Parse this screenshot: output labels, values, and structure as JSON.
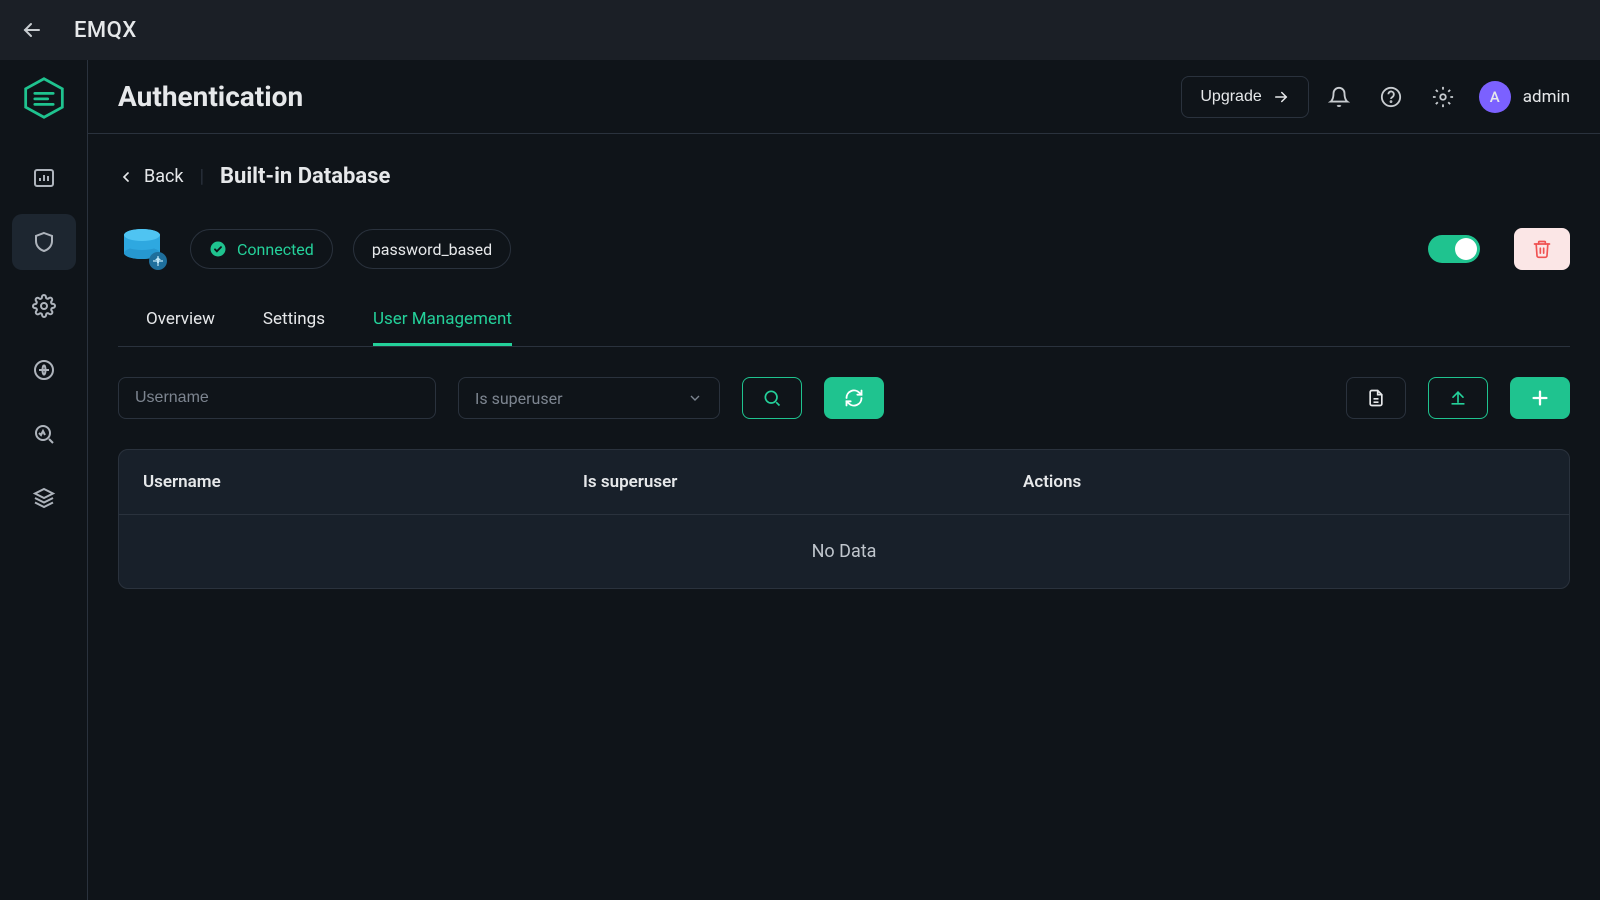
{
  "app": {
    "brand": "EMQX"
  },
  "header": {
    "title": "Authentication",
    "upgrade_label": "Upgrade",
    "user_initial": "A",
    "user_name": "admin"
  },
  "crumb": {
    "back_label": "Back",
    "title": "Built-in Database"
  },
  "resource": {
    "status_label": "Connected",
    "mechanism_label": "password_based",
    "enabled": true
  },
  "tabs": [
    {
      "label": "Overview",
      "active": false
    },
    {
      "label": "Settings",
      "active": false
    },
    {
      "label": "User Management",
      "active": true
    }
  ],
  "filters": {
    "username_placeholder": "Username",
    "superuser_placeholder": "Is superuser"
  },
  "table": {
    "columns": {
      "username": "Username",
      "superuser": "Is superuser",
      "actions": "Actions"
    },
    "empty_label": "No Data",
    "rows": []
  }
}
